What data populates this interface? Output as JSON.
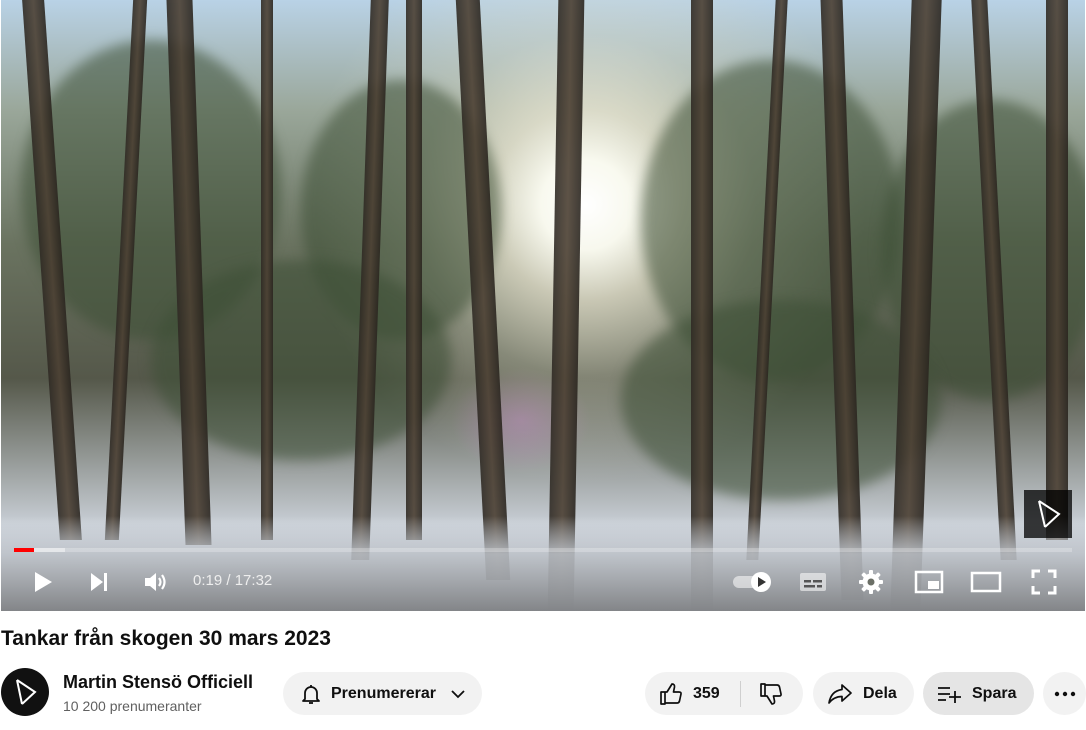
{
  "video": {
    "time_current": "0:19",
    "time_separator": "/",
    "time_total": "17:32",
    "progress_played_fraction": 0.019,
    "progress_buffered_fraction": 0.048,
    "autoplay_on": true
  },
  "title": "Tankar från skogen 30 mars 2023",
  "channel": {
    "name": "Martin Stensö Officiell",
    "subscribers": "10 200 prenumeranter"
  },
  "actions": {
    "subscribe_label": "Prenumererar",
    "like_count": "359",
    "share_label": "Dela",
    "save_label": "Spara"
  },
  "colors": {
    "progress": "#ff0000",
    "pill_bg": "#f2f2f2",
    "save_pill_bg": "#e5e5e5"
  },
  "icons": [
    "play-icon",
    "next-icon",
    "volume-icon",
    "autoplay-toggle",
    "subtitles-icon",
    "settings-icon",
    "miniplayer-icon",
    "theater-icon",
    "fullscreen-icon",
    "bell-icon",
    "chevron-down-icon",
    "like-icon",
    "dislike-icon",
    "share-icon",
    "save-icon",
    "more-icon"
  ]
}
